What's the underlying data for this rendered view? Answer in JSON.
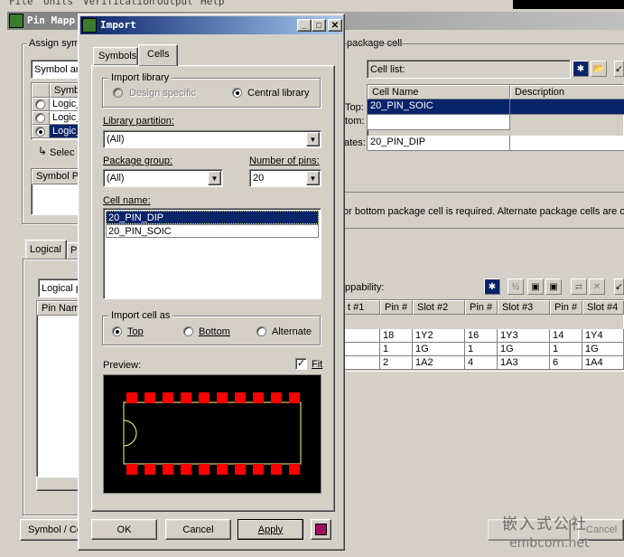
{
  "menu": [
    "File",
    "Units",
    "Verification",
    "Output",
    "Help"
  ],
  "main_window": {
    "title": "Pin Mapp",
    "assign_label": "Assign symb",
    "symbol_combo": "Symbol an",
    "symbols_header": "Symb",
    "symbol_rows": [
      "Logic_",
      "Logic_",
      "Logic_"
    ],
    "select_label": "Selec",
    "symbol_p_header": "Symbol P",
    "package_cell_label": "package cell",
    "cell_list_label": "Cell list:",
    "cell_list_headers": [
      "Cell Name",
      "Description"
    ],
    "top_label": "Top:",
    "bottom_label": "ttom:",
    "alternates_label": "ates:",
    "top_cell": "20_PIN_SOIC",
    "alternate_cell": "20_PIN_DIP",
    "hint_text": "or bottom package cell is required.  Alternate package cells are op",
    "tab_logical": "Logical",
    "tab_p": "P",
    "logical_combo": "Logical p",
    "pin_name_header": "Pin Nam",
    "mappability_label": "ppability:",
    "pin_table_headers": [
      "t #1",
      "Pin #",
      "Slot #2",
      "Pin #",
      "Slot #3",
      "Pin #",
      "Slot #4"
    ],
    "pin_table_rows": [
      [
        "18",
        "1Y2",
        "16",
        "1Y3",
        "14",
        "1Y4"
      ],
      [
        "1",
        "1G",
        "1",
        "1G",
        "1",
        "1G"
      ],
      [
        "2",
        "1A2",
        "4",
        "1A3",
        "6",
        "1A4"
      ]
    ],
    "symbol_cell_button": "Symbol / Ce",
    "cancel_button": "Cancel"
  },
  "dialog": {
    "title": "Import",
    "tabs": [
      "Symbols",
      "Cells"
    ],
    "import_library_label": "Import library",
    "design_specific": "Design specific",
    "central_library": "Central library",
    "library_partition_label": "Library partition:",
    "library_partition_value": "(All)",
    "package_group_label": "Package group:",
    "package_group_value": "(All)",
    "number_of_pins_label": "Number of pins:",
    "number_of_pins_value": "20",
    "cell_name_label": "Cell name:",
    "cell_names": [
      "20_PIN_DIP",
      "20_PIN_SOIC"
    ],
    "import_cell_as_label": "Import cell as",
    "opt_top": "Top",
    "opt_bottom": "Bottom",
    "opt_alternate": "Alternate",
    "preview_label": "Preview:",
    "fit_label": "Fit",
    "ok_button": "OK",
    "cancel_button": "Cancel",
    "apply_button": "Apply"
  },
  "watermark": {
    "line1": "嵌入式公社",
    "line2": "embcom.net"
  },
  "colors": {
    "selection": "#0a246a",
    "pad_red": "#ff0000",
    "outline_yellow": "#ffff80",
    "preview_bg": "#000000"
  }
}
